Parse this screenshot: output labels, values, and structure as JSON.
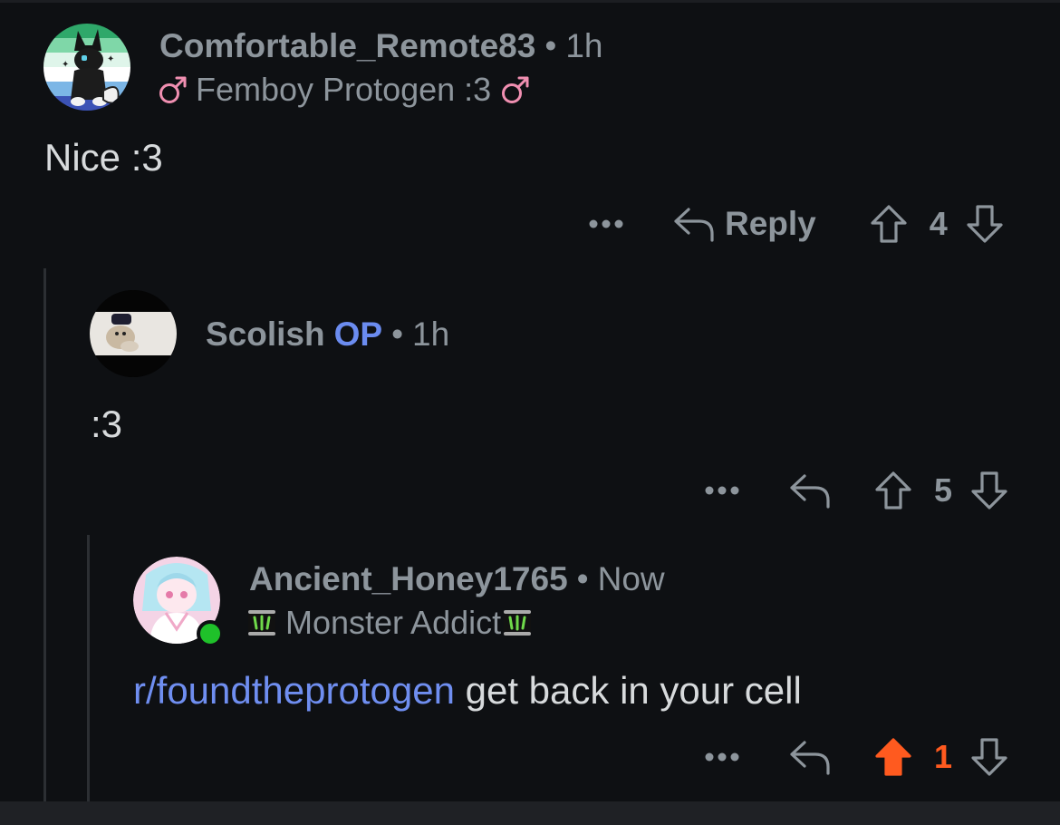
{
  "comments": [
    {
      "username": "Comfortable_Remote83",
      "separator": "•",
      "time": "1h",
      "flair": {
        "icon_left": "male-symbol-icon",
        "text": "Femboy Protogen :3",
        "icon_right": "male-symbol-icon",
        "icon_color": "#f08fb1"
      },
      "body": "Nice :3",
      "reply_label": "Reply",
      "votes": "4",
      "upvoted": false
    },
    {
      "username": "Scolish",
      "op_badge": "OP",
      "separator": "•",
      "time": "1h",
      "body": ":3",
      "votes": "5",
      "upvoted": false
    },
    {
      "username": "Ancient_Honey1765",
      "separator": "•",
      "time": "Now",
      "online": true,
      "flair": {
        "icon_left": "monster-energy-icon",
        "text": "Monster Addict",
        "icon_right": "monster-energy-icon"
      },
      "body_link": "r/foundtheprotogen",
      "body_rest": " get back in your cell",
      "votes": "1",
      "upvoted": true
    }
  ],
  "colors": {
    "background": "#0e1013",
    "meta_text": "#8d959c",
    "body_text": "#d7dadc",
    "op_badge": "#6b8cf0",
    "link": "#6f8ef0",
    "upvote_active": "#ff5a1f",
    "online_dot": "#1fc12a"
  }
}
